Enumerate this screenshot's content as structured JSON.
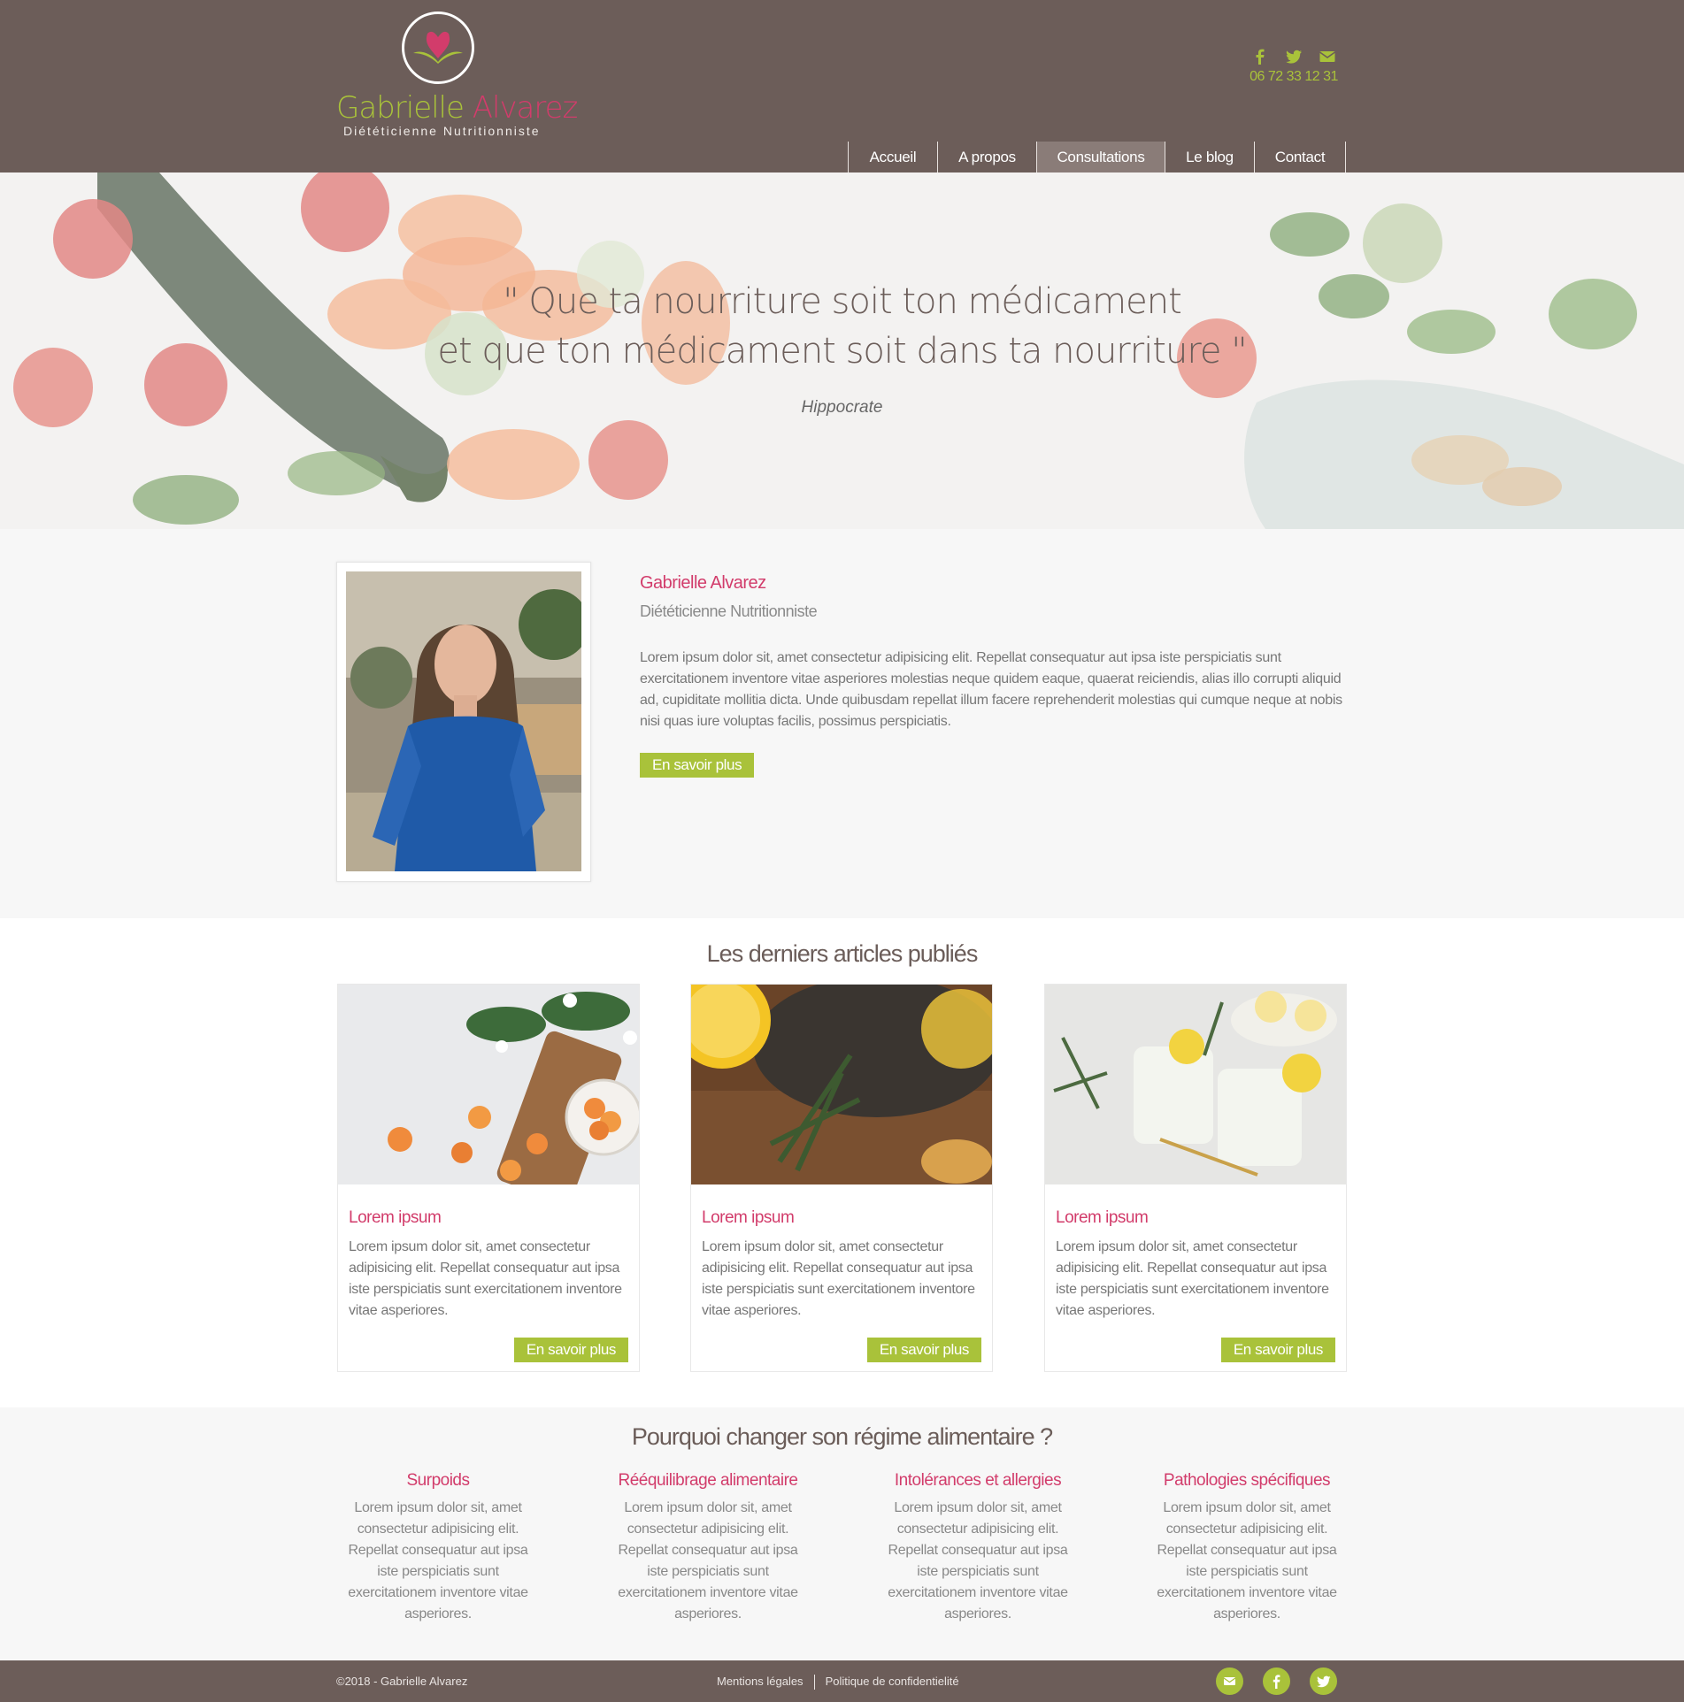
{
  "header": {
    "logo": {
      "first_name": "Gabrielle",
      "last_name": "Alvarez",
      "subtitle": "Diététicienne Nutritionniste"
    },
    "social": {
      "icons": [
        "facebook-icon",
        "twitter-icon",
        "envelope-icon"
      ],
      "color": "#a9c23a"
    },
    "phone": "06 72 33 12 31",
    "nav": [
      {
        "label": "Accueil",
        "active": false
      },
      {
        "label": "A propos",
        "active": false
      },
      {
        "label": "Consultations",
        "active": true
      },
      {
        "label": "Le blog",
        "active": false
      },
      {
        "label": "Contact",
        "active": false
      }
    ]
  },
  "hero": {
    "quote_line1": "\" Que ta nourriture soit ton médicament",
    "quote_line2": "et que ton médicament soit dans ta nourriture \"",
    "author": "Hippocrate"
  },
  "about": {
    "name": "Gabrielle Alvarez",
    "role": "Diététicienne Nutritionniste",
    "description": "Lorem ipsum dolor sit, amet consectetur adipisicing elit. Repellat consequatur aut ipsa iste perspiciatis sunt exercitationem inventore vitae asperiores molestias neque quidem eaque, quaerat reiciendis, alias illo corrupti aliquid ad, cupiditate mollitia dicta. Unde quibusdam repellat illum facere reprehenderit molestias qui cumque neque at nobis nisi quas iure voluptas facilis, possimus perspiciatis.",
    "button": "En savoir plus"
  },
  "articles": {
    "title": "Les derniers articles publiés",
    "items": [
      {
        "title": "Lorem ipsum",
        "text": "Lorem ipsum dolor sit, amet consectetur adipisicing elit. Repellat consequatur aut ipsa iste perspiciatis sunt exercitationem inventore vitae asperiores.",
        "button": "En savoir plus"
      },
      {
        "title": "Lorem ipsum",
        "text": "Lorem ipsum dolor sit, amet consectetur adipisicing elit. Repellat consequatur aut ipsa iste perspiciatis sunt exercitationem inventore vitae asperiores.",
        "button": "En savoir plus"
      },
      {
        "title": "Lorem ipsum",
        "text": "Lorem ipsum dolor sit, amet consectetur adipisicing elit. Repellat consequatur aut ipsa iste perspiciatis sunt exercitationem inventore vitae asperiores.",
        "button": "En savoir plus"
      }
    ]
  },
  "why": {
    "title": "Pourquoi changer son régime alimentaire ?",
    "items": [
      {
        "title": "Surpoids",
        "text": "Lorem ipsum dolor sit, amet consectetur adipisicing elit. Repellat consequatur aut ipsa iste perspiciatis sunt exercitationem inventore vitae asperiores."
      },
      {
        "title": "Rééquilibrage alimentaire",
        "text": "Lorem ipsum dolor sit, amet consectetur adipisicing elit. Repellat consequatur aut ipsa iste perspiciatis sunt exercitationem inventore vitae asperiores."
      },
      {
        "title": "Intolérances et allergies",
        "text": "Lorem ipsum dolor sit, amet consectetur adipisicing elit. Repellat consequatur aut ipsa iste perspiciatis sunt exercitationem inventore vitae asperiores."
      },
      {
        "title": "Pathologies spécifiques",
        "text": "Lorem ipsum dolor sit, amet consectetur adipisicing elit. Repellat consequatur aut ipsa iste perspiciatis sunt exercitationem inventore vitae asperiores."
      }
    ]
  },
  "footer": {
    "copyright": "©2018 - Gabrielle Alvarez",
    "legal": "Mentions légales",
    "privacy": "Politique de confidentielité",
    "social": [
      "envelope-icon",
      "facebook-icon",
      "twitter-icon"
    ]
  },
  "colors": {
    "brand_brown": "#6c5d59",
    "accent_green": "#a9c23a",
    "accent_pink": "#d23c6b"
  }
}
